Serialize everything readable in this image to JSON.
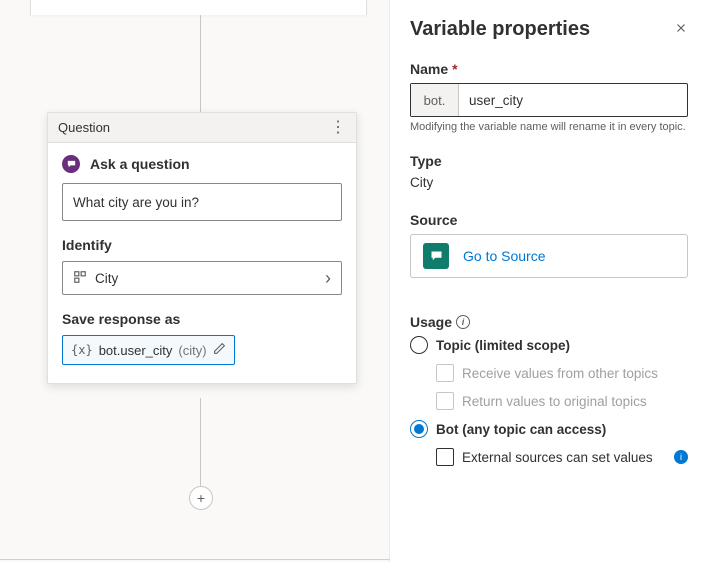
{
  "canvas": {
    "card_header": "Question",
    "ask_label": "Ask a question",
    "question_text": "What city are you in?",
    "identify_label": "Identify",
    "entity_value": "City",
    "save_label": "Save response as",
    "var_name": "bot.user_city",
    "var_type": "(city)"
  },
  "panel": {
    "title": "Variable properties",
    "name_label": "Name",
    "name_prefix": "bot.",
    "name_value": "user_city",
    "name_hint": "Modifying the variable name will rename it in every topic.",
    "type_label": "Type",
    "type_value": "City",
    "source_label": "Source",
    "go_to_source": "Go to Source",
    "usage_label": "Usage",
    "scope_topic": "Topic (limited scope)",
    "receive_values": "Receive values from other topics",
    "return_values": "Return values to original topics",
    "scope_bot": "Bot (any topic can access)",
    "external_sources": "External sources can set values"
  }
}
